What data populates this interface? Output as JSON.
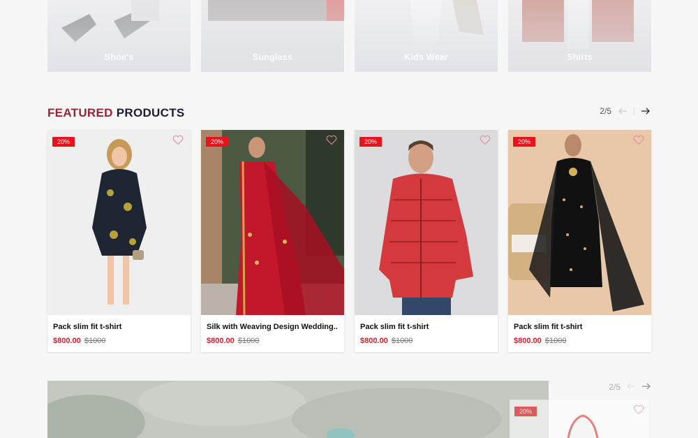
{
  "categories": [
    {
      "label": "Shoe's"
    },
    {
      "label": "Sunglass"
    },
    {
      "label": "Kids Wear"
    },
    {
      "label": "Shirts"
    }
  ],
  "featured": {
    "title_part1": "FEATURED",
    "title_part2": "PRODUCTS",
    "pager": "2/5",
    "products": [
      {
        "badge": "20%",
        "name": "Pack slim fit t-shirt",
        "price": "$800.00",
        "old_price": "$1000"
      },
      {
        "badge": "20%",
        "name": "Silk with Weaving Design Wedding..",
        "price": "$800.00",
        "old_price": "$1000"
      },
      {
        "badge": "20%",
        "name": "Pack slim fit t-shirt",
        "price": "$800.00",
        "old_price": "$1000"
      },
      {
        "badge": "20%",
        "name": "Pack slim fit t-shirt",
        "price": "$800.00",
        "old_price": "$1000"
      }
    ]
  },
  "next_section": {
    "pager": "2/5",
    "badge": "20%"
  },
  "colors": {
    "accent_red": "#9b2335",
    "title_navy": "#1e1b38",
    "badge_red": "#e8141c",
    "price_red": "#d62030"
  }
}
